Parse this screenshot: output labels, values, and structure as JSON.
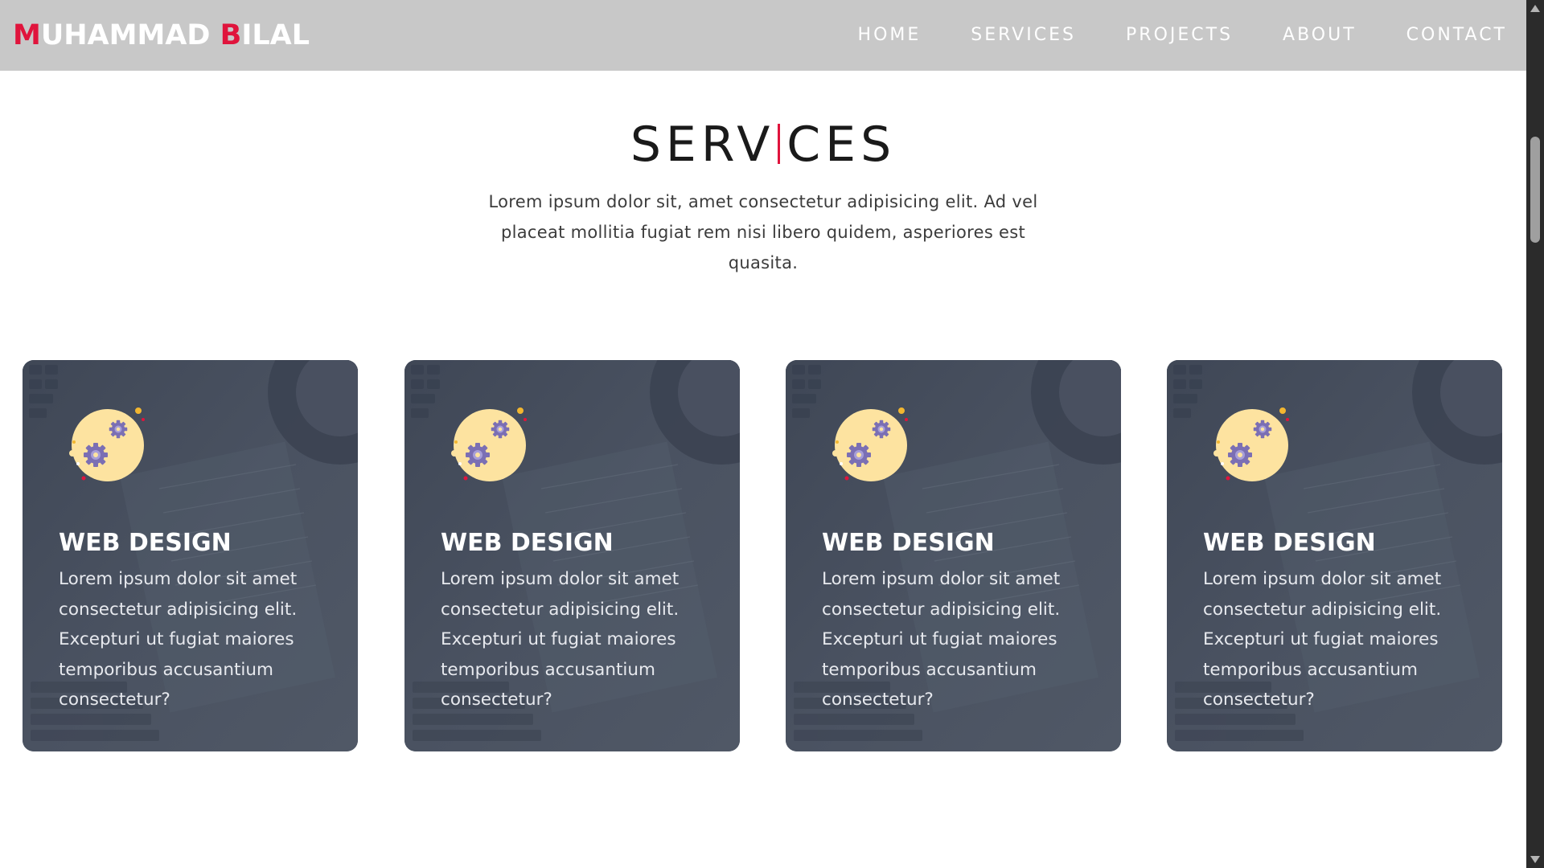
{
  "brand": {
    "first_initial": "M",
    "first_rest": "UHAMMAD ",
    "last_initial": "B",
    "last_rest": "ILAL",
    "accent_color": "#e0143c"
  },
  "nav": {
    "items": [
      {
        "label": "HOME"
      },
      {
        "label": "SERVICES"
      },
      {
        "label": "PROJECTS"
      },
      {
        "label": "ABOUT"
      },
      {
        "label": "CONTACT"
      }
    ]
  },
  "section": {
    "title_part1": "SERV",
    "title_part2": "CES",
    "description": "Lorem ipsum dolor sit, amet consectetur adipisicing elit. Ad vel placeat mollitia fugiat rem nisi libero quidem, asperiores est quasita."
  },
  "cards": [
    {
      "icon": "gears-icon",
      "title": "WEB DESIGN",
      "text": "Lorem ipsum dolor sit amet consectetur adipisicing elit. Excepturi ut fugiat maiores temporibus accusantium consectetur?"
    },
    {
      "icon": "gears-icon",
      "title": "WEB DESIGN",
      "text": "Lorem ipsum dolor sit amet consectetur adipisicing elit. Excepturi ut fugiat maiores temporibus accusantium consectetur?"
    },
    {
      "icon": "gears-icon",
      "title": "WEB DESIGN",
      "text": "Lorem ipsum dolor sit amet consectetur adipisicing elit. Excepturi ut fugiat maiores temporibus accusantium consectetur?"
    },
    {
      "icon": "gears-icon",
      "title": "WEB DESIGN",
      "text": "Lorem ipsum dolor sit amet consectetur adipisicing elit. Excepturi ut fugiat maiores temporibus accusantium consectetur?"
    }
  ],
  "colors": {
    "navbar_bg": "#c8c8c8",
    "card_bg": "#4b5563",
    "icon_circle": "#fde3a0",
    "gear": "#7b6fb4"
  }
}
